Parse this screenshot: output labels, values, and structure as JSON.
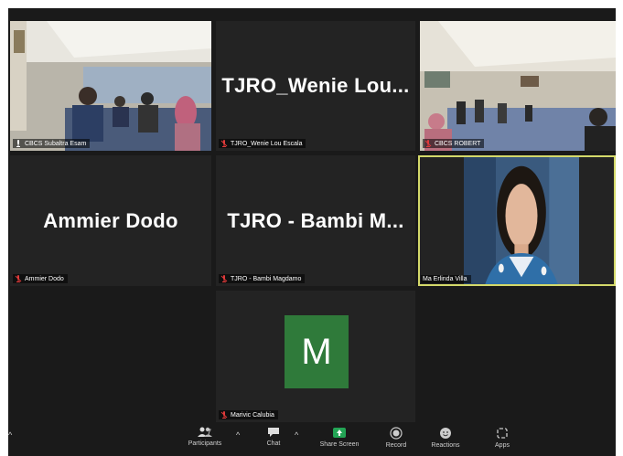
{
  "participants": [
    {
      "name": "CBCS Subaltra Esam",
      "display": ""
    },
    {
      "name": "TJRO_Wenie Lou Escala",
      "display": "TJRO_Wenie  Lou..."
    },
    {
      "name": "CBCS ROBERT",
      "display": ""
    },
    {
      "name": "Ammier Dodo",
      "display": "Ammier Dodo"
    },
    {
      "name": "TJRO - Bambi Magdamo",
      "display": "TJRO  -  Bambi  M..."
    },
    {
      "name": "Ma Erlinda Villa",
      "display": ""
    },
    {
      "name": "Marivic Calubia",
      "display": "",
      "initial": "M"
    }
  ],
  "toolbar": {
    "participants_count": "7",
    "participants_label": "Participants",
    "chat_label": "Chat",
    "share_label": "Share Screen",
    "record_label": "Record",
    "reactions_label": "Reactions",
    "apps_label": "Apps"
  },
  "colors": {
    "active_border": "#d4d96a",
    "avatar_green": "#2f7a3a",
    "share_green": "#23a455"
  }
}
